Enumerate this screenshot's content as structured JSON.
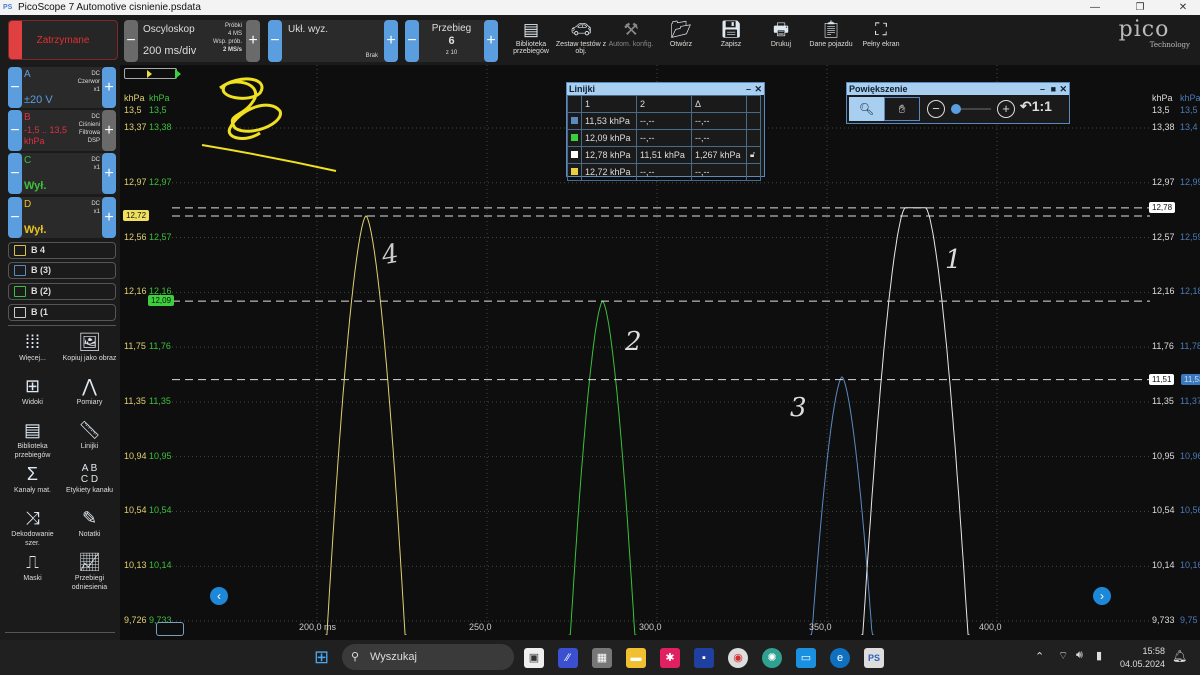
{
  "window": {
    "title": "PicoScope 7 Automotive cisnienie.psdata",
    "app_icon": "PS"
  },
  "toolbar": {
    "stop_label": "Zatrzymane",
    "scope": {
      "mode": "Oscyloskop",
      "timebase": "200 ms/div",
      "samples_label": "Próbki",
      "samples": "4 MS",
      "rate_label": "Wsp. prób.",
      "rate": "2 MS/s"
    },
    "trigger": {
      "label": "Ukł. wyz.",
      "value": "Brak"
    },
    "waveform": {
      "label": "Przebieg",
      "current": "6",
      "total": "z 10"
    },
    "buttons": [
      {
        "label": "Biblioteka przebiegów",
        "icon": "library-icon"
      },
      {
        "label": "Zestaw testów z obj.",
        "icon": "car-icon"
      },
      {
        "label": "Autom. konfig.",
        "icon": "wand-icon"
      },
      {
        "label": "Otwórz",
        "icon": "folder-icon"
      },
      {
        "label": "Zapisz",
        "icon": "save-icon"
      },
      {
        "label": "Drukuj",
        "icon": "print-icon"
      },
      {
        "label": "Dane pojazdu",
        "icon": "clipboard-icon"
      },
      {
        "label": "Pełny ekran",
        "icon": "fullscreen-icon"
      }
    ],
    "logo": {
      "name": "pico",
      "sub": "Technology"
    }
  },
  "channels": [
    {
      "id": "A",
      "coupling": "DC",
      "probe": "Czerwor",
      "mult": "x1",
      "value": "±20 V",
      "color": "#5a9ee0"
    },
    {
      "id": "B",
      "coupling": "DC",
      "probe": "Ciśnieni",
      "mult": "Filtrowa",
      "extra": "DSP",
      "value": "-1,5 .. 13,5",
      "unit": "khPa",
      "color": "#e03040"
    },
    {
      "id": "C",
      "coupling": "DC",
      "mult": "x1",
      "value": "Wył.",
      "color": "#3cc03c"
    },
    {
      "id": "D",
      "coupling": "DC",
      "mult": "x1",
      "value": "Wył.",
      "color": "#e8c020"
    }
  ],
  "reference_buttons": [
    {
      "label": "B 4",
      "color": "#d8c050"
    },
    {
      "label": "B (3)",
      "color": "#5a8ac0"
    },
    {
      "label": "B (2)",
      "color": "#3cc03c"
    },
    {
      "label": "B (1",
      "color": "#cccccc"
    }
  ],
  "tools": [
    {
      "label": "Więcej...",
      "icon": "more-grid-icon"
    },
    {
      "label": "Kopiuj jako obraz",
      "icon": "copy-image-icon"
    },
    {
      "label": "Widoki",
      "icon": "views-icon"
    },
    {
      "label": "Pomiary",
      "icon": "compass-icon"
    },
    {
      "label": "Biblioteka przebiegów",
      "icon": "library-icon"
    },
    {
      "label": "Linijki",
      "icon": "ruler-icon"
    },
    {
      "label": "Kanały mat.",
      "icon": "sigma-icon"
    },
    {
      "label": "Etykiety kanału",
      "icon": "abcd-icon"
    },
    {
      "label": "Dekodowanie szer.",
      "icon": "decode-icon"
    },
    {
      "label": "Notatki",
      "icon": "notes-icon"
    },
    {
      "label": "Maski",
      "icon": "mask-icon"
    },
    {
      "label": "Przebiegi odniesienia",
      "icon": "reference-icon"
    }
  ],
  "rulers_panel": {
    "title": "Linijki",
    "headers": [
      "1",
      "2",
      "Δ"
    ],
    "rows": [
      {
        "color": "#5a8ac0",
        "c1": "11,53 khPa",
        "c2": "--,--",
        "d": "--,--"
      },
      {
        "color": "#3cd03c",
        "c1": "12,09 khPa",
        "c2": "--,--",
        "d": "--,--"
      },
      {
        "color": "#ffffff",
        "c1": "12,78 khPa",
        "c2": "11,51 khPa",
        "d": "1,267 khPa",
        "lock": true
      },
      {
        "color": "#e8d040",
        "c1": "12,72 khPa",
        "c2": "--,--",
        "d": "--,--"
      }
    ]
  },
  "zoom_panel": {
    "title": "Powiększenie",
    "ratio": "1:1"
  },
  "chart_data": {
    "type": "line",
    "xlabel": "ms",
    "xlim": [
      169,
      431
    ],
    "x_ticks": [
      "200,0 ms",
      "250,0",
      "300,0",
      "350,0",
      "400,0"
    ],
    "x_tick_values": [
      200,
      250,
      300,
      350,
      400
    ],
    "ylim": [
      9.726,
      13.37
    ],
    "axes": {
      "left_yellow": {
        "unit": "khPa",
        "top": "13,5",
        "ticks": [
          "13,37",
          "12,97",
          "12,56",
          "12,16",
          "11,75",
          "11,35",
          "10,94",
          "10,54",
          "10,13",
          "9,726"
        ]
      },
      "left_green": {
        "unit": "khPa",
        "top": "13,5",
        "ticks": [
          "13,38",
          "12,97",
          "12,57",
          "12,16",
          "11,76",
          "11,35",
          "10,95",
          "10,54",
          "10,14",
          "9,733"
        ]
      },
      "right_white": {
        "unit": "khPa",
        "top": "13,5",
        "ticks": [
          "13,38",
          "12,97",
          "12,57",
          "12,16",
          "11,76",
          "11,35",
          "10,95",
          "10,54",
          "10,14",
          "9,733"
        ]
      },
      "right_blue": {
        "unit": "khPa",
        "top": "13,5",
        "ticks": [
          "13,4",
          "12,99",
          "12,59",
          "12,18",
          "11,78",
          "11,37",
          "10,96",
          "10,56",
          "10,16",
          "9,75"
        ]
      }
    },
    "series": [
      {
        "name": "B 4",
        "color": "#e0d070",
        "peak_ms": 214.4,
        "peak_kPa": 12.72,
        "half_width_ms": 12
      },
      {
        "name": "B (2)",
        "color": "#3cc03c",
        "peak_ms": 284,
        "peak_kPa": 12.09,
        "half_width_ms": 10
      },
      {
        "name": "B (3)",
        "color": "#5a8ac0",
        "peak_ms": 354.4,
        "peak_kPa": 11.53,
        "half_width_ms": 9.5
      },
      {
        "name": "B (1",
        "color": "#e8e8e8",
        "peak_ms": 376,
        "peak_kPa": 12.78,
        "half_width_ms": 13,
        "flat_ms": 3
      }
    ],
    "rulers": [
      {
        "value": 12.78,
        "label": "12,78",
        "side": "right",
        "color": "#ffffff"
      },
      {
        "value": 12.72,
        "label": "12,72",
        "side": "left",
        "color": "#f0e060"
      },
      {
        "value": 12.09,
        "label": "12,09",
        "side": "left",
        "color": "#3cd03c"
      },
      {
        "value": 11.51,
        "label": "11,51",
        "side": "right",
        "color": "#ffffff",
        "extra": "11,53"
      }
    ],
    "annotations": [
      "4",
      "2",
      "3",
      "1"
    ]
  },
  "taskbar": {
    "search": "Wyszukaj",
    "time": "15:58",
    "date": "04.05.2024"
  }
}
